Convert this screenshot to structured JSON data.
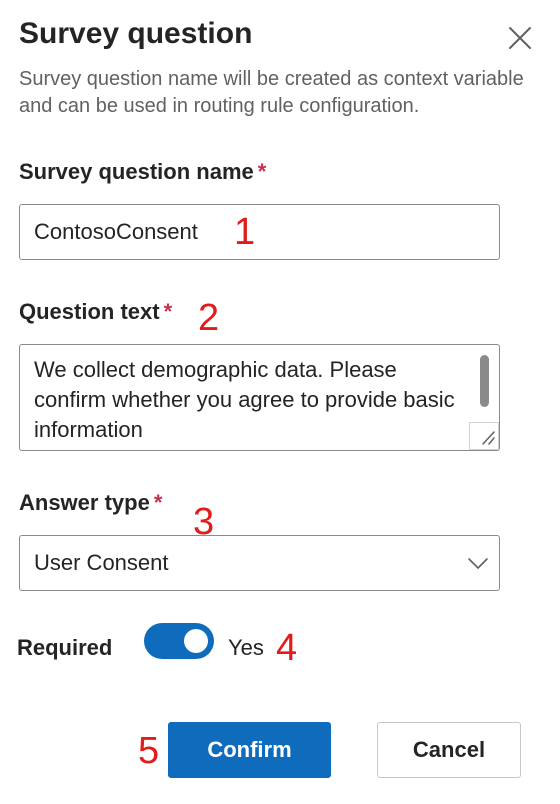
{
  "dialog": {
    "title": "Survey question",
    "description": "Survey question name will be created as context variable and can be used in routing rule configuration."
  },
  "fields": {
    "name": {
      "label": "Survey question name",
      "required_mark": "*",
      "value": "ContosoConsent"
    },
    "question_text": {
      "label": "Question text",
      "required_mark": "*",
      "value": "We collect demographic data. Please confirm whether you agree to provide basic information"
    },
    "answer_type": {
      "label": "Answer type",
      "required_mark": "*",
      "selected": "User Consent"
    },
    "required": {
      "label": "Required",
      "toggle_on": true,
      "state_text": "Yes"
    }
  },
  "markers": [
    "1",
    "2",
    "3",
    "4",
    "5"
  ],
  "buttons": {
    "confirm": "Confirm",
    "cancel": "Cancel"
  },
  "icons": {
    "close": "close-icon",
    "chevron": "chevron-down-icon",
    "resize": "resize-handle-icon"
  },
  "colors": {
    "primary": "#0f6cbd",
    "required_star": "#c4314b",
    "marker": "#e21b1b",
    "text": "#242424",
    "muted_text": "#616161"
  }
}
